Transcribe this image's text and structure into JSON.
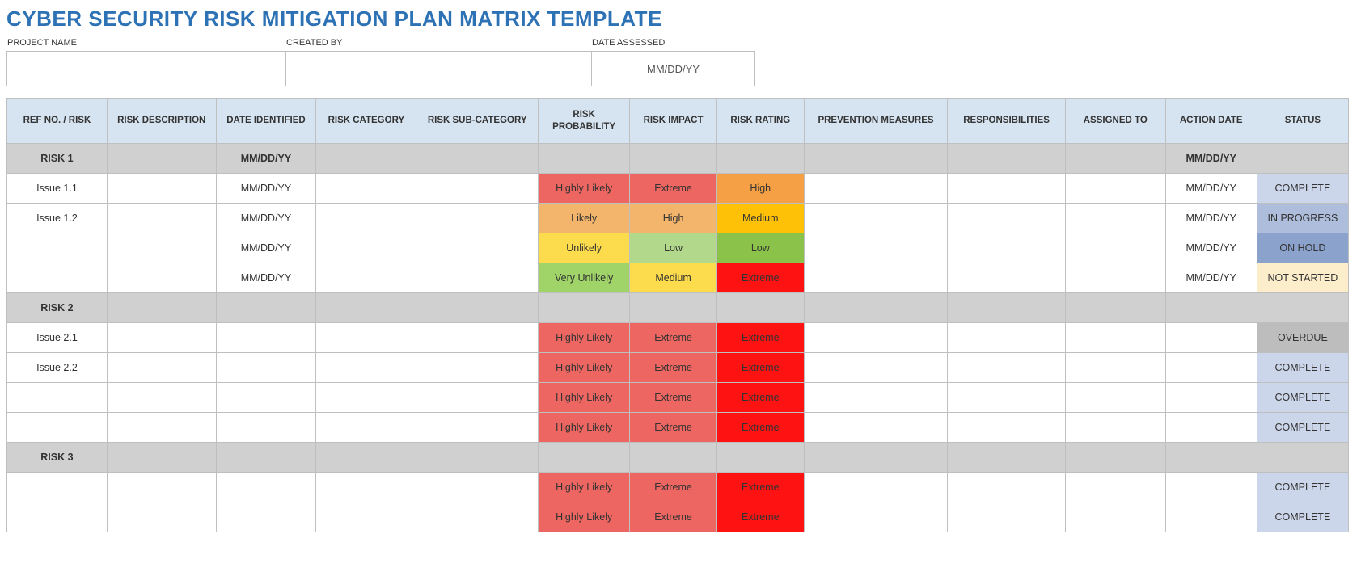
{
  "title": "CYBER SECURITY RISK MITIGATION PLAN MATRIX TEMPLATE",
  "meta": {
    "projectName": {
      "label": "PROJECT NAME",
      "value": ""
    },
    "createdBy": {
      "label": "CREATED BY",
      "value": ""
    },
    "dateAssessed": {
      "label": "DATE ASSESSED",
      "value": "MM/DD/YY"
    }
  },
  "columns": [
    "REF NO. / RISK",
    "RISK DESCRIPTION",
    "DATE IDENTIFIED",
    "RISK CATEGORY",
    "RISK SUB-CATEGORY",
    "RISK PROBABILITY",
    "RISK IMPACT",
    "RISK RATING",
    "PREVENTION MEASURES",
    "RESPONSIBILITIES",
    "ASSIGNED TO",
    "ACTION DATE",
    "STATUS"
  ],
  "rows": [
    {
      "type": "group",
      "ref": "RISK 1",
      "dateIdentified": "MM/DD/YY",
      "actionDate": "MM/DD/YY"
    },
    {
      "type": "issue",
      "ref": "Issue 1.1",
      "dateIdentified": "MM/DD/YY",
      "prob": "Highly Likely",
      "probClass": "bg-red-soft",
      "impact": "Extreme",
      "impactClass": "bg-red-soft",
      "rating": "High",
      "ratingClass": "bg-orange",
      "actionDate": "MM/DD/YY",
      "status": "COMPLETE",
      "statusClass": "st-complete"
    },
    {
      "type": "issue",
      "ref": "Issue 1.2",
      "dateIdentified": "MM/DD/YY",
      "prob": "Likely",
      "probClass": "bg-orange-soft",
      "impact": "High",
      "impactClass": "bg-orange-soft",
      "rating": "Medium",
      "ratingClass": "bg-amber",
      "actionDate": "MM/DD/YY",
      "status": "IN PROGRESS",
      "statusClass": "st-inprogress"
    },
    {
      "type": "issue",
      "ref": "",
      "dateIdentified": "MM/DD/YY",
      "prob": "Unlikely",
      "probClass": "bg-yellow",
      "impact": "Low",
      "impactClass": "bg-green-soft",
      "rating": "Low",
      "ratingClass": "bg-green-mid",
      "actionDate": "MM/DD/YY",
      "status": "ON HOLD",
      "statusClass": "st-onhold"
    },
    {
      "type": "issue",
      "ref": "",
      "dateIdentified": "MM/DD/YY",
      "prob": "Very Unlikely",
      "probClass": "bg-green",
      "impact": "Medium",
      "impactClass": "bg-yellow",
      "rating": "Extreme",
      "ratingClass": "bg-red-hard",
      "actionDate": "MM/DD/YY",
      "status": "NOT STARTED",
      "statusClass": "st-notstarted"
    },
    {
      "type": "group",
      "ref": "RISK 2"
    },
    {
      "type": "issue",
      "ref": "Issue 2.1",
      "prob": "Highly Likely",
      "probClass": "bg-red-soft",
      "impact": "Extreme",
      "impactClass": "bg-red-soft",
      "rating": "Extreme",
      "ratingClass": "bg-red-hard",
      "status": "OVERDUE",
      "statusClass": "st-overdue"
    },
    {
      "type": "issue",
      "ref": "Issue 2.2",
      "prob": "Highly Likely",
      "probClass": "bg-red-soft",
      "impact": "Extreme",
      "impactClass": "bg-red-soft",
      "rating": "Extreme",
      "ratingClass": "bg-red-hard",
      "status": "COMPLETE",
      "statusClass": "st-complete"
    },
    {
      "type": "issue",
      "ref": "",
      "prob": "Highly Likely",
      "probClass": "bg-red-soft",
      "impact": "Extreme",
      "impactClass": "bg-red-soft",
      "rating": "Extreme",
      "ratingClass": "bg-red-hard",
      "status": "COMPLETE",
      "statusClass": "st-complete"
    },
    {
      "type": "issue",
      "ref": "",
      "prob": "Highly Likely",
      "probClass": "bg-red-soft",
      "impact": "Extreme",
      "impactClass": "bg-red-soft",
      "rating": "Extreme",
      "ratingClass": "bg-red-hard",
      "status": "COMPLETE",
      "statusClass": "st-complete"
    },
    {
      "type": "group",
      "ref": "RISK 3"
    },
    {
      "type": "issue",
      "ref": "",
      "prob": "Highly Likely",
      "probClass": "bg-red-soft",
      "impact": "Extreme",
      "impactClass": "bg-red-soft",
      "rating": "Extreme",
      "ratingClass": "bg-red-hard",
      "status": "COMPLETE",
      "statusClass": "st-complete"
    },
    {
      "type": "issue",
      "ref": "",
      "prob": "Highly Likely",
      "probClass": "bg-red-soft",
      "impact": "Extreme",
      "impactClass": "bg-red-soft",
      "rating": "Extreme",
      "ratingClass": "bg-red-hard",
      "status": "COMPLETE",
      "statusClass": "st-complete"
    }
  ]
}
